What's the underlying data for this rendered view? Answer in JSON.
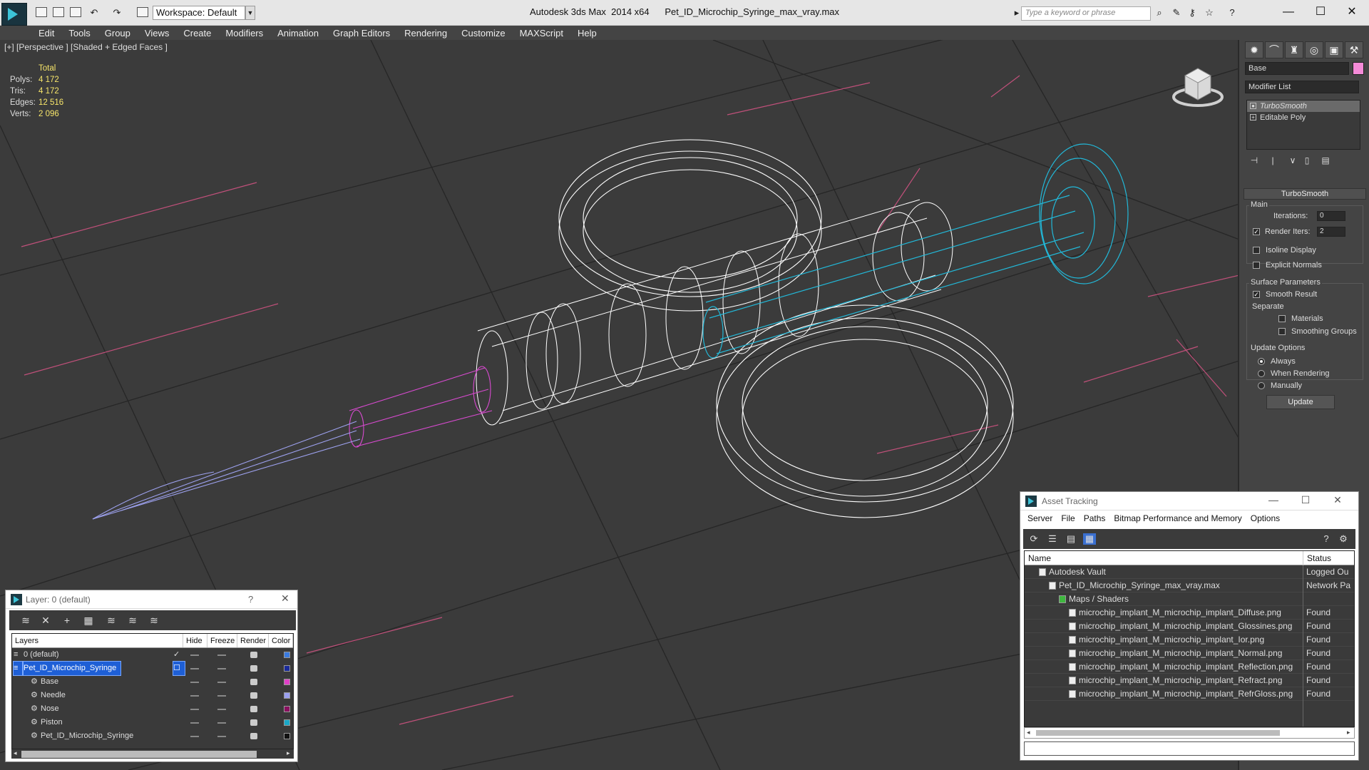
{
  "titlebar": {
    "workspace": "Workspace: Default",
    "title": "Autodesk 3ds Max  2014 x64      Pet_ID_Microchip_Syringe_max_vray.max",
    "search_placeholder": "Type a keyword or phrase"
  },
  "menu": [
    "Edit",
    "Tools",
    "Group",
    "Views",
    "Create",
    "Modifiers",
    "Animation",
    "Graph Editors",
    "Rendering",
    "Customize",
    "MAXScript",
    "Help"
  ],
  "viewport": {
    "label": "[+] [Perspective ] [Shaded + Edged Faces ]",
    "stats": {
      "total_label": "Total",
      "rows": [
        {
          "k": "Polys:",
          "v": "4 172"
        },
        {
          "k": "Tris:",
          "v": "4 172"
        },
        {
          "k": "Edges:",
          "v": "12 516"
        },
        {
          "k": "Verts:",
          "v": "2 096"
        }
      ]
    }
  },
  "command_panel": {
    "object_name": "Base",
    "object_color": "#f58bd8",
    "modifier_list": "Modifier List",
    "stack": [
      "TurboSmooth",
      "Editable Poly"
    ],
    "rollout_title": "TurboSmooth",
    "main_group": "Main",
    "iterations_label": "Iterations:",
    "iterations_value": "0",
    "render_iters_label": "Render Iters:",
    "render_iters_value": "2",
    "isoline_display": "Isoline Display",
    "explicit_normals": "Explicit Normals",
    "surface_params": "Surface Parameters",
    "smooth_result": "Smooth Result",
    "separate": "Separate",
    "materials": "Materials",
    "smoothing_groups": "Smoothing Groups",
    "update_options": "Update Options",
    "always": "Always",
    "when_rendering": "When Rendering",
    "manually": "Manually",
    "update_button": "Update"
  },
  "layer_dialog": {
    "title": "Layer: 0 (default)",
    "help": "?",
    "columns": [
      "Layers",
      "Hide",
      "Freeze",
      "Render",
      "Color"
    ],
    "rows": [
      {
        "name": "0 (default)",
        "indent": 0,
        "color": "#3a7be0",
        "current": true
      },
      {
        "name": "Pet_ID_Microchip_Syringe",
        "indent": 0,
        "color": "#1a2a9a",
        "selected": true
      },
      {
        "name": "Base",
        "indent": 1,
        "color": "#e040c8"
      },
      {
        "name": "Needle",
        "indent": 1,
        "color": "#9aa0f0"
      },
      {
        "name": "Nose",
        "indent": 1,
        "color": "#8a1060"
      },
      {
        "name": "Piston",
        "indent": 1,
        "color": "#1aa8c8"
      },
      {
        "name": "Pet_ID_Microchip_Syringe",
        "indent": 1,
        "color": "#111111"
      }
    ]
  },
  "asset_dialog": {
    "title": "Asset Tracking",
    "menu": [
      "Server",
      "File",
      "Paths",
      "Bitmap Performance and Memory",
      "Options"
    ],
    "col_name": "Name",
    "col_status": "Status",
    "rows": [
      {
        "name": "Autodesk Vault",
        "status": "Logged Ou",
        "indent": 1
      },
      {
        "name": "Pet_ID_Microchip_Syringe_max_vray.max",
        "status": "Network Pa",
        "indent": 2
      },
      {
        "name": "Maps / Shaders",
        "status": "",
        "indent": 3
      },
      {
        "name": "microchip_implant_M_microchip_implant_Diffuse.png",
        "status": "Found",
        "indent": 4
      },
      {
        "name": "microchip_implant_M_microchip_implant_Glossines.png",
        "status": "Found",
        "indent": 4
      },
      {
        "name": "microchip_implant_M_microchip_implant_Ior.png",
        "status": "Found",
        "indent": 4
      },
      {
        "name": "microchip_implant_M_microchip_implant_Normal.png",
        "status": "Found",
        "indent": 4
      },
      {
        "name": "microchip_implant_M_microchip_implant_Reflection.png",
        "status": "Found",
        "indent": 4
      },
      {
        "name": "microchip_implant_M_microchip_implant_Refract.png",
        "status": "Found",
        "indent": 4
      },
      {
        "name": "microchip_implant_M_microchip_implant_RefrGloss.png",
        "status": "Found",
        "indent": 4
      }
    ]
  }
}
